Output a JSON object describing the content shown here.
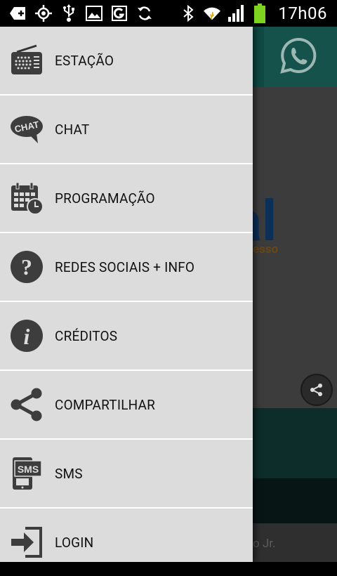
{
  "status_bar": {
    "time": "17h06",
    "icons": [
      "add-notification-icon",
      "gps-icon",
      "usb-icon",
      "image-icon",
      "g-icon",
      "sync-icon",
      "bluetooth-icon",
      "wifi-icon",
      "signal-icon",
      "battery-icon"
    ]
  },
  "background_app": {
    "big_text": "al",
    "sub_text": "esso",
    "footer_text": "o Jr.",
    "colors": {
      "header": "#0f4a45",
      "band": "#0d2d2b"
    }
  },
  "drawer": {
    "items": [
      {
        "label": "ESTAÇÃO",
        "icon": "radio-icon"
      },
      {
        "label": "CHAT",
        "icon": "chat-bubble-icon"
      },
      {
        "label": "PROGRAMAÇÃO",
        "icon": "calendar-icon"
      },
      {
        "label": "REDES SOCIAIS + INFO",
        "icon": "help-icon"
      },
      {
        "label": "CRÉDITOS",
        "icon": "info-icon"
      },
      {
        "label": "COMPARTILHAR",
        "icon": "share-icon"
      },
      {
        "label": "SMS",
        "icon": "sms-phone-icon"
      },
      {
        "label": "LOGIN",
        "icon": "login-icon"
      }
    ]
  }
}
